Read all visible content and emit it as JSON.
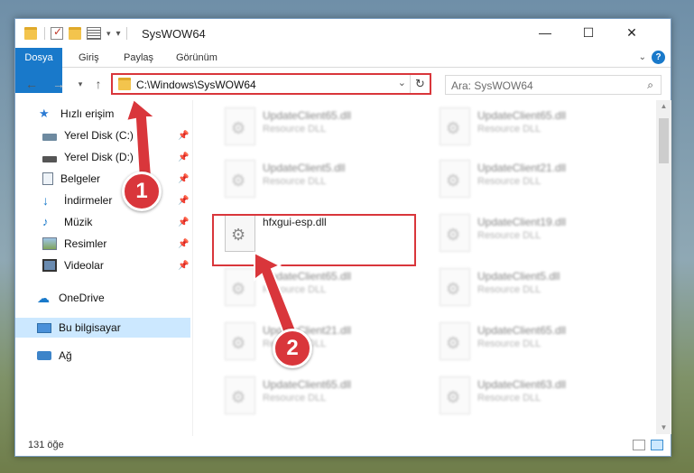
{
  "window": {
    "title": "SysWOW64"
  },
  "titlebar": {
    "minimize": "—",
    "maximize": "☐",
    "close": "✕"
  },
  "ribbon": {
    "tabs": [
      "Dosya",
      "Giriş",
      "Paylaş",
      "Görünüm"
    ],
    "help": "?"
  },
  "address": {
    "path": "C:\\Windows\\SysWOW64",
    "search_placeholder": "Ara: SysWOW64"
  },
  "sidebar": {
    "quick_access": "Hızlı erişim",
    "items": [
      {
        "label": "Yerel Disk (C:)",
        "icon": "drive-icon"
      },
      {
        "label": "Yerel Disk (D:)",
        "icon": "drive-icon"
      },
      {
        "label": "Belgeler",
        "icon": "documents-icon"
      },
      {
        "label": "İndirmeler",
        "icon": "download-icon"
      },
      {
        "label": "Müzik",
        "icon": "music-icon"
      },
      {
        "label": "Resimler",
        "icon": "pictures-icon"
      },
      {
        "label": "Videolar",
        "icon": "video-icon"
      }
    ],
    "onedrive": "OneDrive",
    "this_pc": "Bu bilgisayar",
    "network": "Ağ"
  },
  "files": {
    "highlighted": {
      "name": "hfxgui-esp.dll"
    },
    "col1": [
      {
        "name": "UpdateClient65.dll",
        "type": "Resource DLL"
      },
      {
        "name": "UpdateClient5.dll",
        "type": "Resource DLL"
      },
      {
        "name": "UpdateClient65.dll",
        "type": "Resource DLL"
      },
      {
        "name": "UpdateClient21.dll",
        "type": "Resource DLL"
      },
      {
        "name": "UpdateClient65.dll",
        "type": "Resource DLL"
      }
    ],
    "col2": [
      {
        "name": "UpdateClient65.dll",
        "type": "Resource DLL"
      },
      {
        "name": "UpdateClient21.dll",
        "type": "Resource DLL"
      },
      {
        "name": "UpdateClient19.dll",
        "type": "Resource DLL"
      },
      {
        "name": "UpdateClient5.dll",
        "type": "Resource DLL"
      },
      {
        "name": "UpdateClient65.dll",
        "type": "Resource DLL"
      },
      {
        "name": "UpdateClient63.dll",
        "type": "Resource DLL"
      }
    ]
  },
  "status": {
    "count": "131 öğe"
  },
  "callouts": {
    "one": "1",
    "two": "2"
  },
  "colors": {
    "accent": "#1979ca",
    "highlight": "#d9363b",
    "selection": "#cce8ff"
  }
}
